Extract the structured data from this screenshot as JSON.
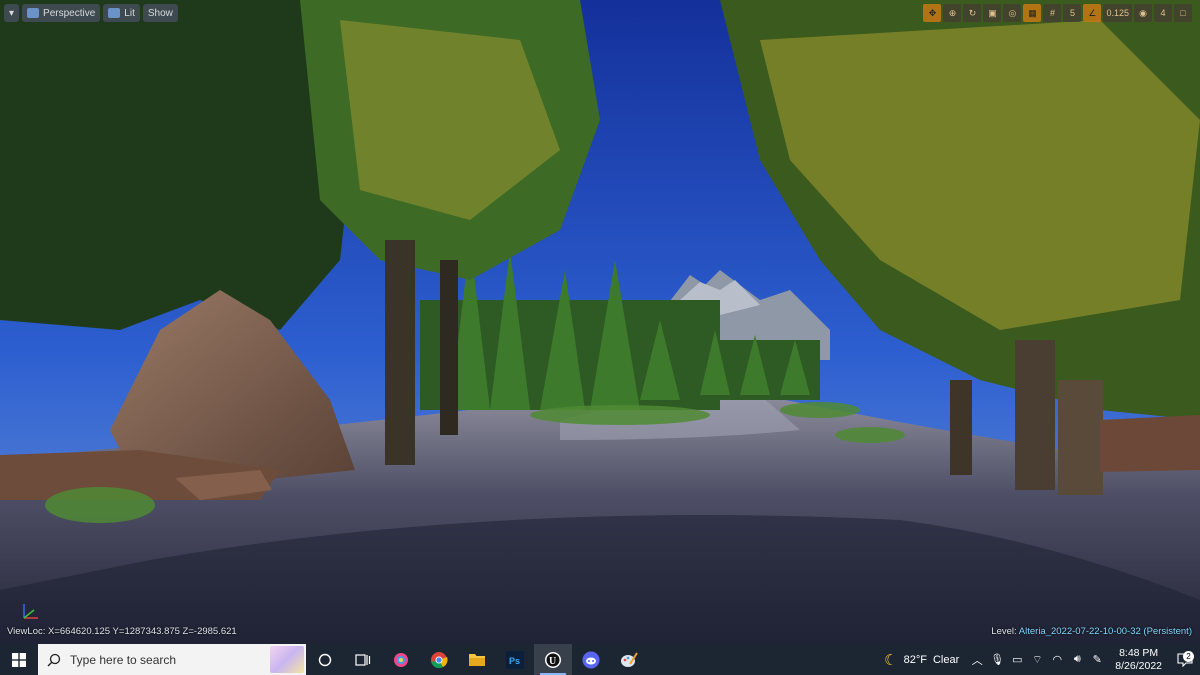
{
  "viewport": {
    "buttons": {
      "menu_icon": "chevron-down-icon",
      "perspective": "Perspective",
      "lit": "Lit",
      "show": "Show"
    },
    "right_toolbar": {
      "grid_snap": "5",
      "angle_snap": "0.125",
      "camera_speed": "4"
    },
    "viewloc": "ViewLoc: X=664620.125 Y=1287343.875 Z=-2985.621",
    "level_label": "Level:",
    "level_name": "Alteria_2022-07-22-10-00-32 (Persistent)"
  },
  "taskbar": {
    "search_placeholder": "Type here to search",
    "apps": [
      "task-view",
      "cortana",
      "paint",
      "chrome",
      "file-explorer",
      "photoshop",
      "unreal-engine",
      "discord",
      "paint-brush"
    ],
    "weather_temp": "82°F",
    "weather_condition": "Clear",
    "time": "8:48 PM",
    "date": "8/26/2022",
    "notification_count": "2"
  }
}
